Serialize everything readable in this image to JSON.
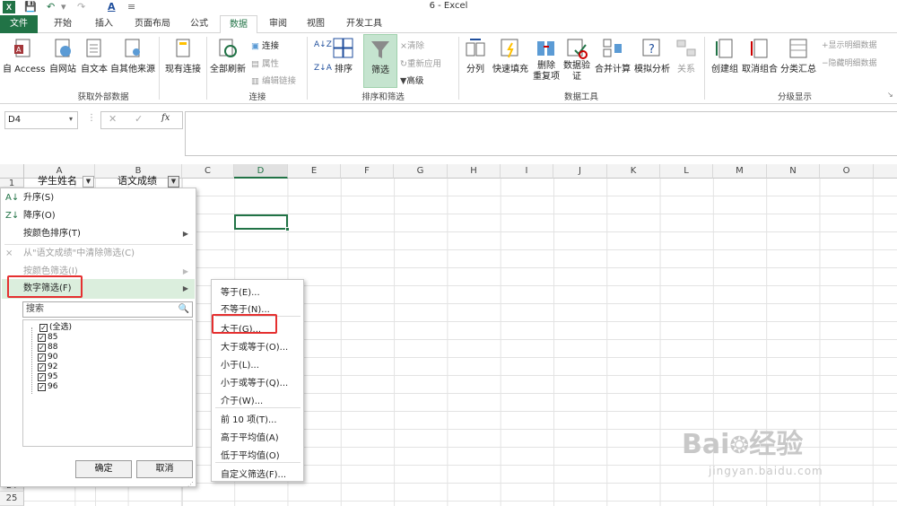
{
  "window": {
    "title": "6 - Excel"
  },
  "tabs": [
    "文件",
    "开始",
    "插入",
    "页面布局",
    "公式",
    "数据",
    "审阅",
    "视图",
    "开发工具"
  ],
  "ribbon": {
    "ext_buttons": [
      "自 Access",
      "自网站",
      "自文本",
      "自其他来源",
      "现有连接"
    ],
    "group_external": "获取外部数据",
    "refresh": "全部刷新",
    "conn_items": [
      "连接",
      "属性",
      "编辑链接"
    ],
    "group_conn": "连接",
    "sort_label": "排序",
    "filter_label": "筛选",
    "sort_small": [
      "清除",
      "重新应用",
      "高级"
    ],
    "group_sort": "排序和筛选",
    "tools_buttons": [
      "分列",
      "快速填充",
      "删除\n重复项",
      "数据验\n证",
      "合并计算",
      "模拟分析",
      "关系"
    ],
    "group_tools": "数据工具",
    "outline_buttons": [
      "创建组",
      "取消组合",
      "分类汇总"
    ],
    "outline_small": [
      "显示明细数据",
      "隐藏明细数据"
    ],
    "group_outline": "分级显示"
  },
  "formula": {
    "namebox": "D4",
    "fx": "fx"
  },
  "grid": {
    "columns": [
      "A",
      "B",
      "C",
      "D",
      "E",
      "F",
      "G",
      "H",
      "I",
      "J",
      "K",
      "L",
      "M",
      "N",
      "O"
    ],
    "rows": [
      "1",
      "24",
      "25"
    ],
    "A1": "学生姓名",
    "B1": "语文成绩"
  },
  "filter_menu": {
    "items": [
      "升序(S)",
      "降序(O)",
      "按颜色排序(T)",
      "从\"语文成绩\"中清除筛选(C)",
      "按颜色筛选(I)",
      "数字筛选(F)"
    ],
    "search_placeholder": "搜索",
    "values": [
      "(全选)",
      "85",
      "88",
      "90",
      "92",
      "95",
      "96"
    ],
    "ok": "确定",
    "cancel": "取消"
  },
  "submenu": {
    "items": [
      "等于(E)...",
      "不等于(N)...",
      "大于(G)...",
      "大于或等于(O)...",
      "小于(L)...",
      "小于或等于(Q)...",
      "介于(W)...",
      "前 10 项(T)...",
      "高于平均值(A)",
      "低于平均值(O)",
      "自定义筛选(F)..."
    ]
  },
  "watermark": {
    "brand": "Bai",
    "brand2": "经验",
    "url": "jingyan.baidu.com"
  },
  "colors": {
    "excel_green": "#217346",
    "highlight": "#dbeedd",
    "red": "#e53030"
  }
}
